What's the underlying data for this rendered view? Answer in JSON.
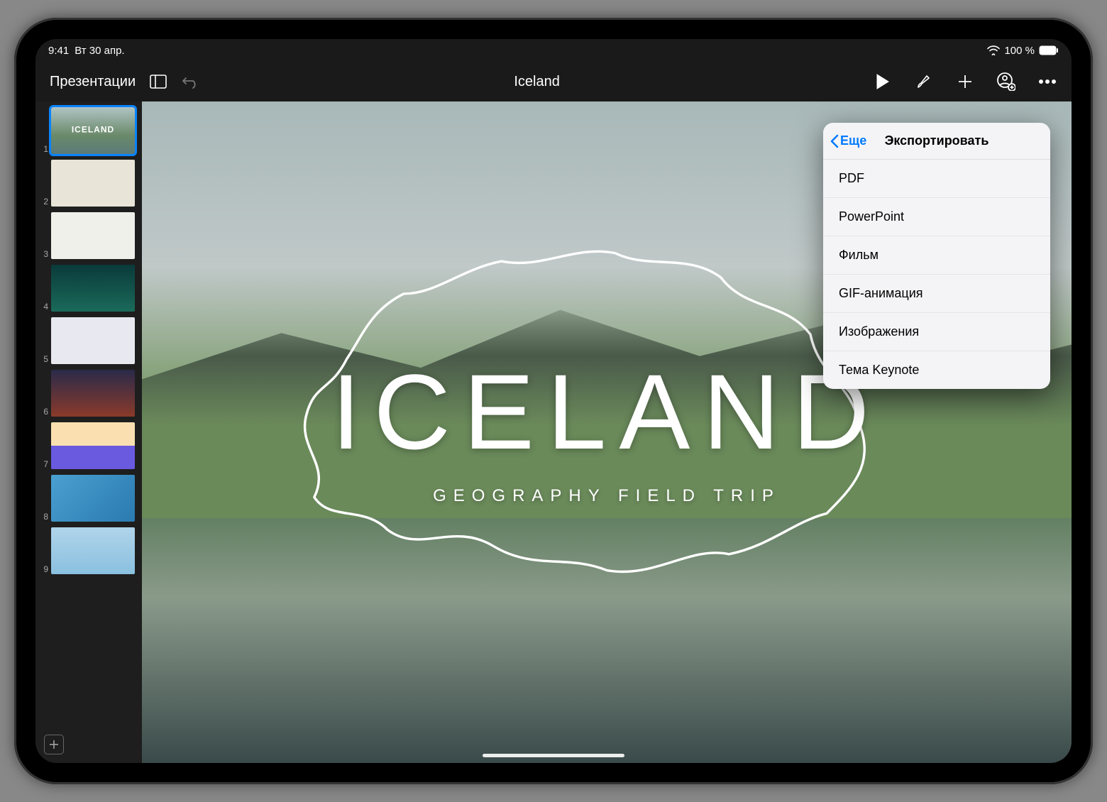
{
  "status": {
    "time": "9:41",
    "date": "Вт 30 апр.",
    "battery_pct": "100 %"
  },
  "toolbar": {
    "back_label": "Презентации",
    "title": "Iceland"
  },
  "popover": {
    "back_label": "Еще",
    "title": "Экспортировать",
    "items": [
      "PDF",
      "PowerPoint",
      "Фильм",
      "GIF-анимация",
      "Изображения",
      "Тема Keynote"
    ]
  },
  "slide": {
    "heading": "ICELAND",
    "subheading": "GEOGRAPHY FIELD TRIP"
  },
  "thumbnails": [
    {
      "n": "1"
    },
    {
      "n": "2"
    },
    {
      "n": "3"
    },
    {
      "n": "4"
    },
    {
      "n": "5"
    },
    {
      "n": "6"
    },
    {
      "n": "7"
    },
    {
      "n": "8"
    },
    {
      "n": "9"
    }
  ]
}
